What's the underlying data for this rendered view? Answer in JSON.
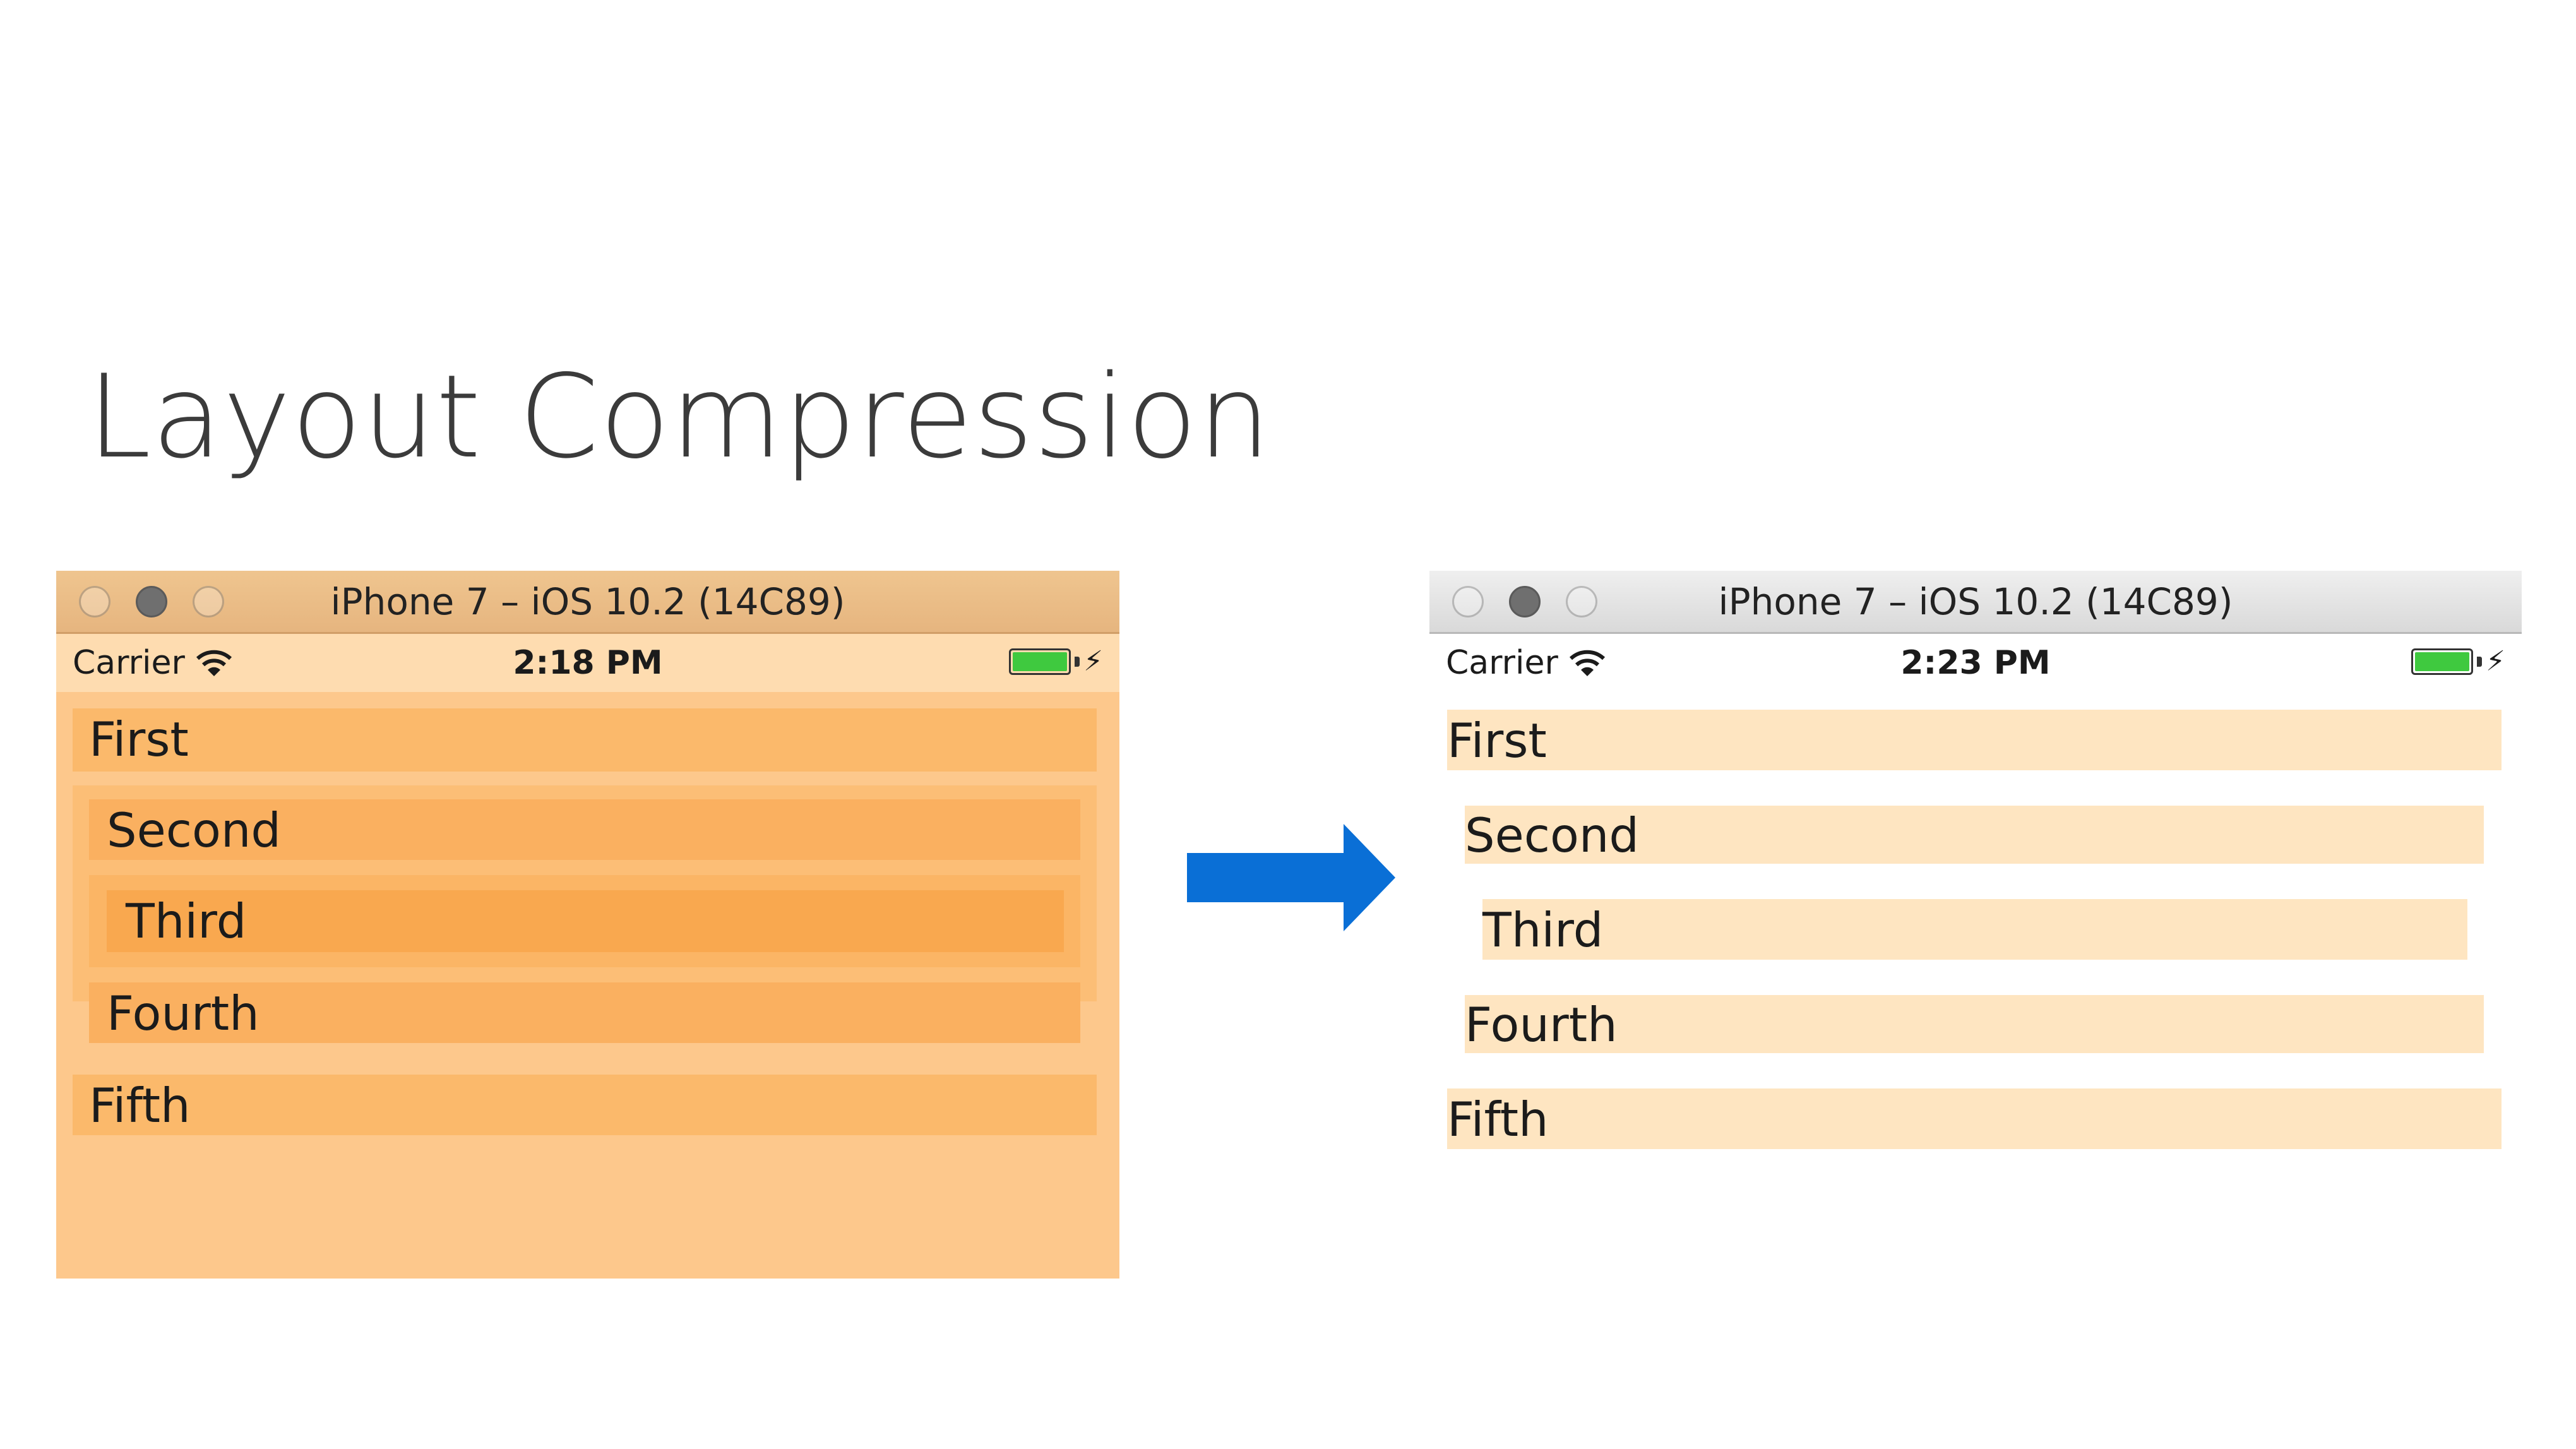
{
  "slide": {
    "title": "Layout Compression"
  },
  "left_simulator": {
    "window_title": "iPhone 7 – iOS 10.2 (14C89)",
    "status": {
      "carrier": "Carrier",
      "time": "2:18 PM"
    },
    "rows": [
      "First",
      "Second",
      "Third",
      "Fourth",
      "Fifth"
    ]
  },
  "right_simulator": {
    "window_title": "iPhone 7 – iOS 10.2 (14C89)",
    "status": {
      "carrier": "Carrier",
      "time": "2:23 PM"
    },
    "rows": [
      "First",
      "Second",
      "Third",
      "Fourth",
      "Fifth"
    ]
  },
  "colors": {
    "arrow": "#0a6fd6",
    "left_background": "#fdc88c",
    "right_row_background": "#fee5c1",
    "battery": "#3fc93f"
  },
  "icons": [
    "wifi-icon",
    "battery-icon",
    "charging-bolt-icon",
    "window-close-icon",
    "window-minimize-icon",
    "window-zoom-icon",
    "right-arrow-icon"
  ]
}
